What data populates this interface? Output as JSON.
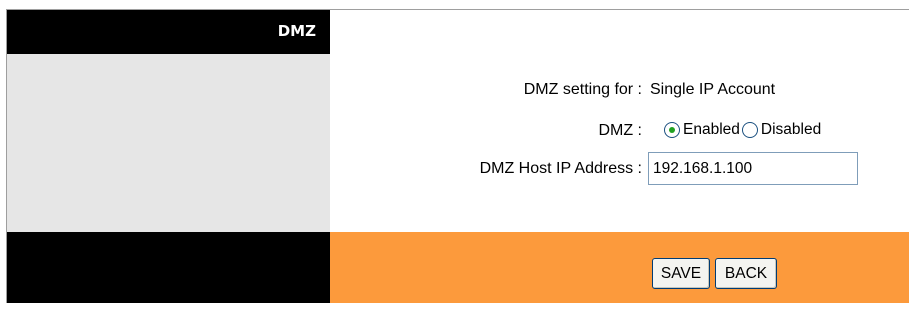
{
  "section": {
    "title": "DMZ"
  },
  "form": {
    "setting_label": "DMZ setting for :",
    "setting_value": "Single IP Account",
    "dmz_label": "DMZ :",
    "dmz_options": [
      {
        "label": "Enabled",
        "selected": true
      },
      {
        "label": "Disabled",
        "selected": false
      }
    ],
    "host_ip_label": "DMZ Host IP Address :",
    "host_ip_value": "192.168.1.100"
  },
  "actions": {
    "save_label": "SAVE",
    "back_label": "BACK"
  },
  "colors": {
    "header_bg": "#000000",
    "sidebar_bg": "#e6e6e6",
    "footer_accent": "#fc9a3c",
    "radio_dot": "#21a121"
  }
}
